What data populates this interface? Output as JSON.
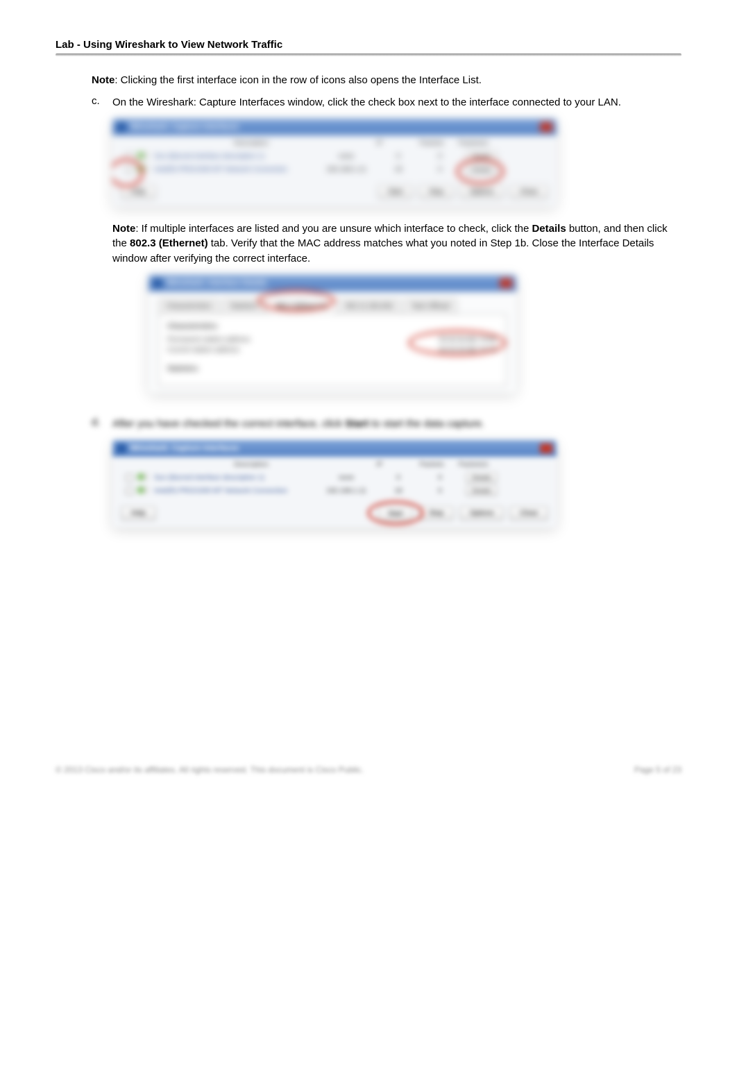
{
  "header": {
    "title": "Lab - Using Wireshark to View Network Traffic"
  },
  "note1": {
    "label": "Note",
    "text": ": Clicking the first interface icon in the row of icons also opens the Interface List."
  },
  "item_c": {
    "marker": "c.",
    "text": "On the Wireshark: Capture Interfaces window, click the check box next to the interface connected to your LAN."
  },
  "note2": {
    "label": "Note",
    "t1": ": If multiple interfaces are listed and you are unsure which interface to check, click the ",
    "bold1": "Details",
    "t2": " button, and then click the ",
    "bold2": "802.3 (Ethernet)",
    "t3": " tab. Verify that the MAC address matches what you noted in Step 1b. Close the Interface Details window after verifying the correct interface."
  },
  "item_d": {
    "marker": "d.",
    "t1": "After you have checked the correct interface, click ",
    "bold1": "Start",
    "t2": " to start the data capture."
  },
  "fig_capture": {
    "title": "Wireshark: Capture Interfaces",
    "hdr_desc": "Description",
    "hdr_ip": "IP",
    "hdr_pkt": "Packets",
    "hdr_pks": "Packets/s",
    "r1_desc": "Sun (blurred interface description 1)",
    "r1_ip": "none",
    "r1_pkt": "0",
    "r1_pks": "0",
    "r2_desc": "Intel(R) PRO/1000 MT Network Connection",
    "r2_ip": "192.168.1.11",
    "r2_pkt": "19",
    "r2_pks": "0",
    "details_btn": "Details",
    "btn_help": "Help",
    "btn_start": "Start",
    "btn_stop": "Stop",
    "btn_options": "Options",
    "btn_close": "Close"
  },
  "fig_details": {
    "title": "Wireshark: Interface Details",
    "tab1": "Characteristics",
    "tab2": "Statistics",
    "tab3": "802.3 (Ethernet)",
    "tab4": "802.11 (WLAN)",
    "tab5": "Task Offload",
    "sect": "Characteristics",
    "r1_l": "Permanent station address",
    "r1_v": "00:50:56:BE:76:8C",
    "r2_l": "Current station address",
    "r2_v": "00:50:56:BE:76:8C",
    "sect2": "Statistics"
  },
  "footer": {
    "left": "© 2013 Cisco and/or its affiliates. All rights reserved. This document is Cisco Public.",
    "right": "Page 5 of 23"
  }
}
